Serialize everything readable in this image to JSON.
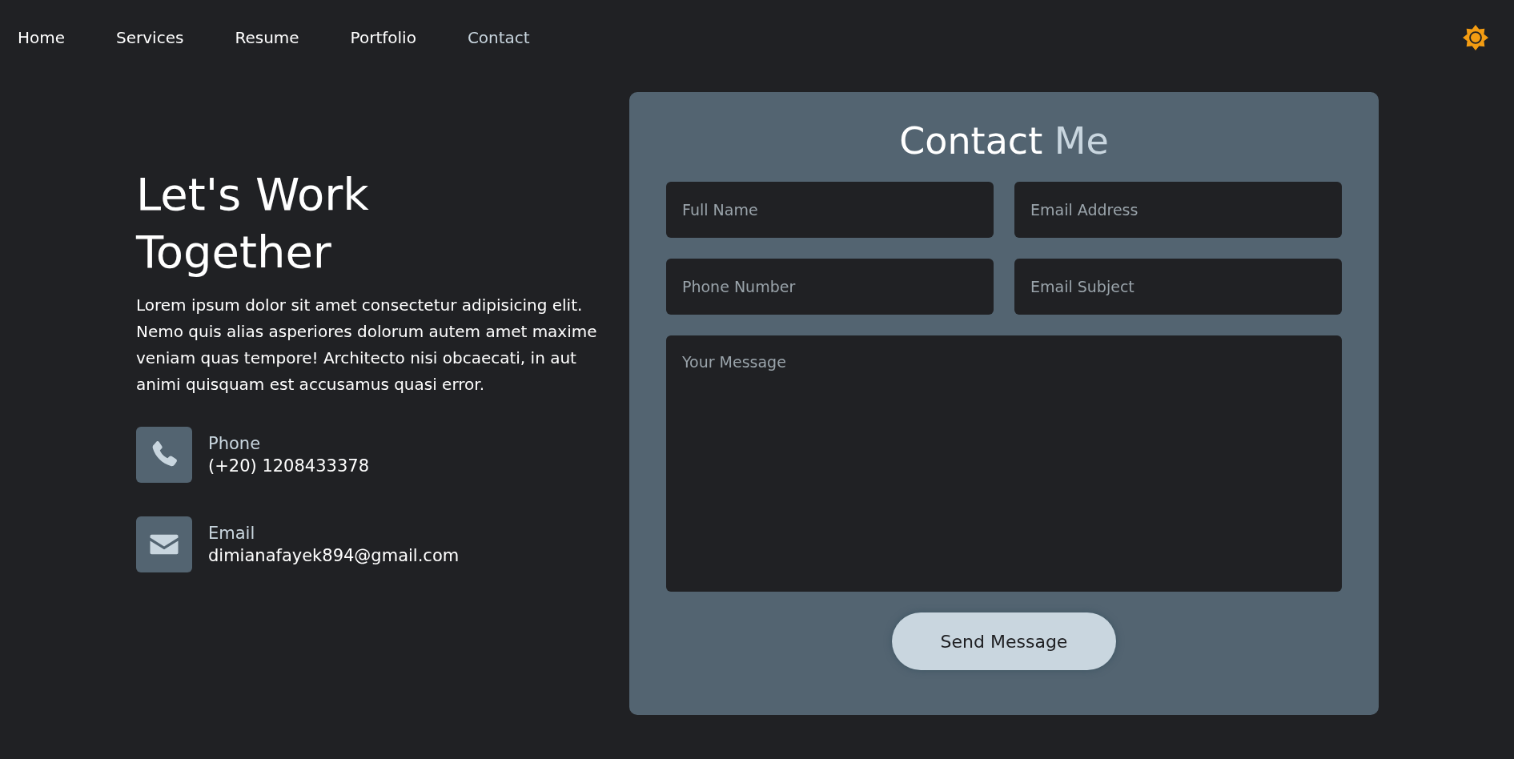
{
  "nav": {
    "items": [
      {
        "label": "Home",
        "selected": false
      },
      {
        "label": "Services",
        "selected": false
      },
      {
        "label": "Resume",
        "selected": false
      },
      {
        "label": "Portfolio",
        "selected": false
      },
      {
        "label": "Contact",
        "selected": true
      }
    ]
  },
  "intro": {
    "heading": "Let's Work Together",
    "text": "Lorem ipsum dolor sit amet consectetur adipisicing elit. Nemo quis alias asperiores dolorum autem amet maxime veniam quas tempore! Architecto nisi obcaecati, in aut animi quisquam est accusamus quasi error.",
    "contacts": [
      {
        "kind": "phone",
        "label": "Phone",
        "value": "(+20) 1208433378"
      },
      {
        "kind": "email",
        "label": "Email",
        "value": "dimianafayek894@gmail.com"
      }
    ]
  },
  "form": {
    "title": "Contact",
    "title_accent": "Me",
    "fields": [
      {
        "kind": "input",
        "placeholder": "Full Name"
      },
      {
        "kind": "input",
        "placeholder": "Email Address"
      },
      {
        "kind": "input",
        "placeholder": "Phone Number"
      },
      {
        "kind": "input",
        "placeholder": "Email Subject"
      },
      {
        "kind": "textarea",
        "placeholder": "Your Message"
      }
    ],
    "button": "Send Message"
  }
}
